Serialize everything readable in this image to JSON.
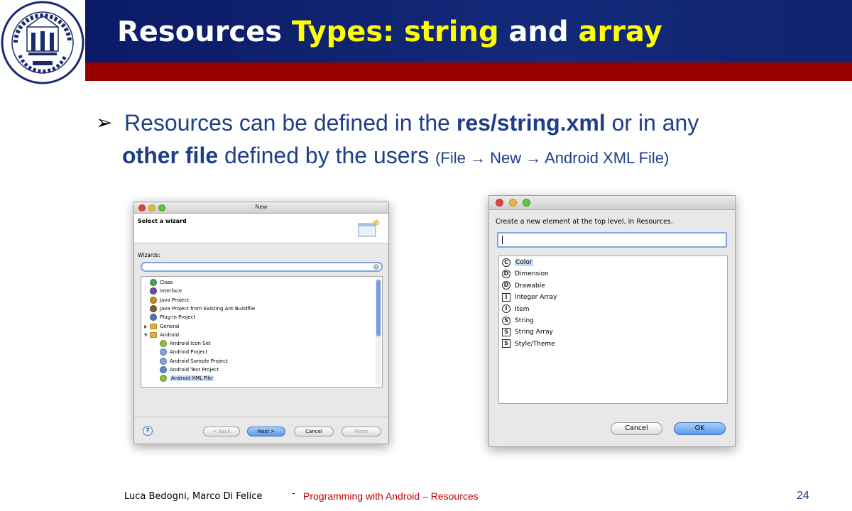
{
  "slide": {
    "title_parts": [
      "Resources ",
      "Types: string",
      " and ",
      "array"
    ],
    "bullet": {
      "line1_a": "Resources can be defined in the ",
      "line1_b": "res/string.xml",
      "line1_c": " or in any",
      "line2_a": "other file",
      "line2_b": " defined by the users ",
      "line2_small": "(File → New → Android XML File)"
    },
    "footer": {
      "authors": "Luca Bedogni, Marco Di Felice",
      "dash": "-",
      "course": "Programming with Android – Resources",
      "page": "24"
    }
  },
  "new_wizard": {
    "title": "New",
    "header": "Select a wizard",
    "wizards_label": "Wizards:",
    "tree": [
      {
        "label": "Class",
        "icon": "class-icon",
        "indent": 0
      },
      {
        "label": "Interface",
        "icon": "interface-icon",
        "indent": 0
      },
      {
        "label": "Java Project",
        "icon": "java-project-icon",
        "indent": 0
      },
      {
        "label": "Java Project from Existing Ant Buildfile",
        "icon": "ant-icon",
        "indent": 0
      },
      {
        "label": "Plug-in Project",
        "icon": "plugin-icon",
        "indent": 0
      },
      {
        "label": "General",
        "icon": "folder-icon",
        "indent": 0
      },
      {
        "label": "Android",
        "icon": "folder-icon",
        "indent": 0
      },
      {
        "label": "Android Icon Set",
        "icon": "android-icon",
        "indent": 1
      },
      {
        "label": "Android Project",
        "icon": "android-project-icon",
        "indent": 1
      },
      {
        "label": "Android Sample Project",
        "icon": "android-sample-icon",
        "indent": 1
      },
      {
        "label": "Android Test Project",
        "icon": "android-test-icon",
        "indent": 1
      },
      {
        "label": "Android XML File",
        "icon": "xml-file-icon",
        "indent": 1
      }
    ],
    "buttons": {
      "back": "< Back",
      "next": "Next >",
      "cancel": "Cancel",
      "finish": "Finish"
    }
  },
  "resources_dialog": {
    "prompt": "Create a new element at the top level, in Resources.",
    "items": [
      {
        "letter": "C",
        "label": "Color",
        "round": true
      },
      {
        "letter": "D",
        "label": "Dimension",
        "round": true
      },
      {
        "letter": "D",
        "label": "Drawable",
        "round": true
      },
      {
        "letter": "I",
        "label": "Integer Array",
        "round": false
      },
      {
        "letter": "I",
        "label": "Item",
        "round": true
      },
      {
        "letter": "S",
        "label": "String",
        "round": true
      },
      {
        "letter": "S",
        "label": "String Array",
        "round": false
      },
      {
        "letter": "S",
        "label": "Style/Theme",
        "round": false
      }
    ],
    "buttons": {
      "cancel": "Cancel",
      "ok": "OK"
    }
  }
}
